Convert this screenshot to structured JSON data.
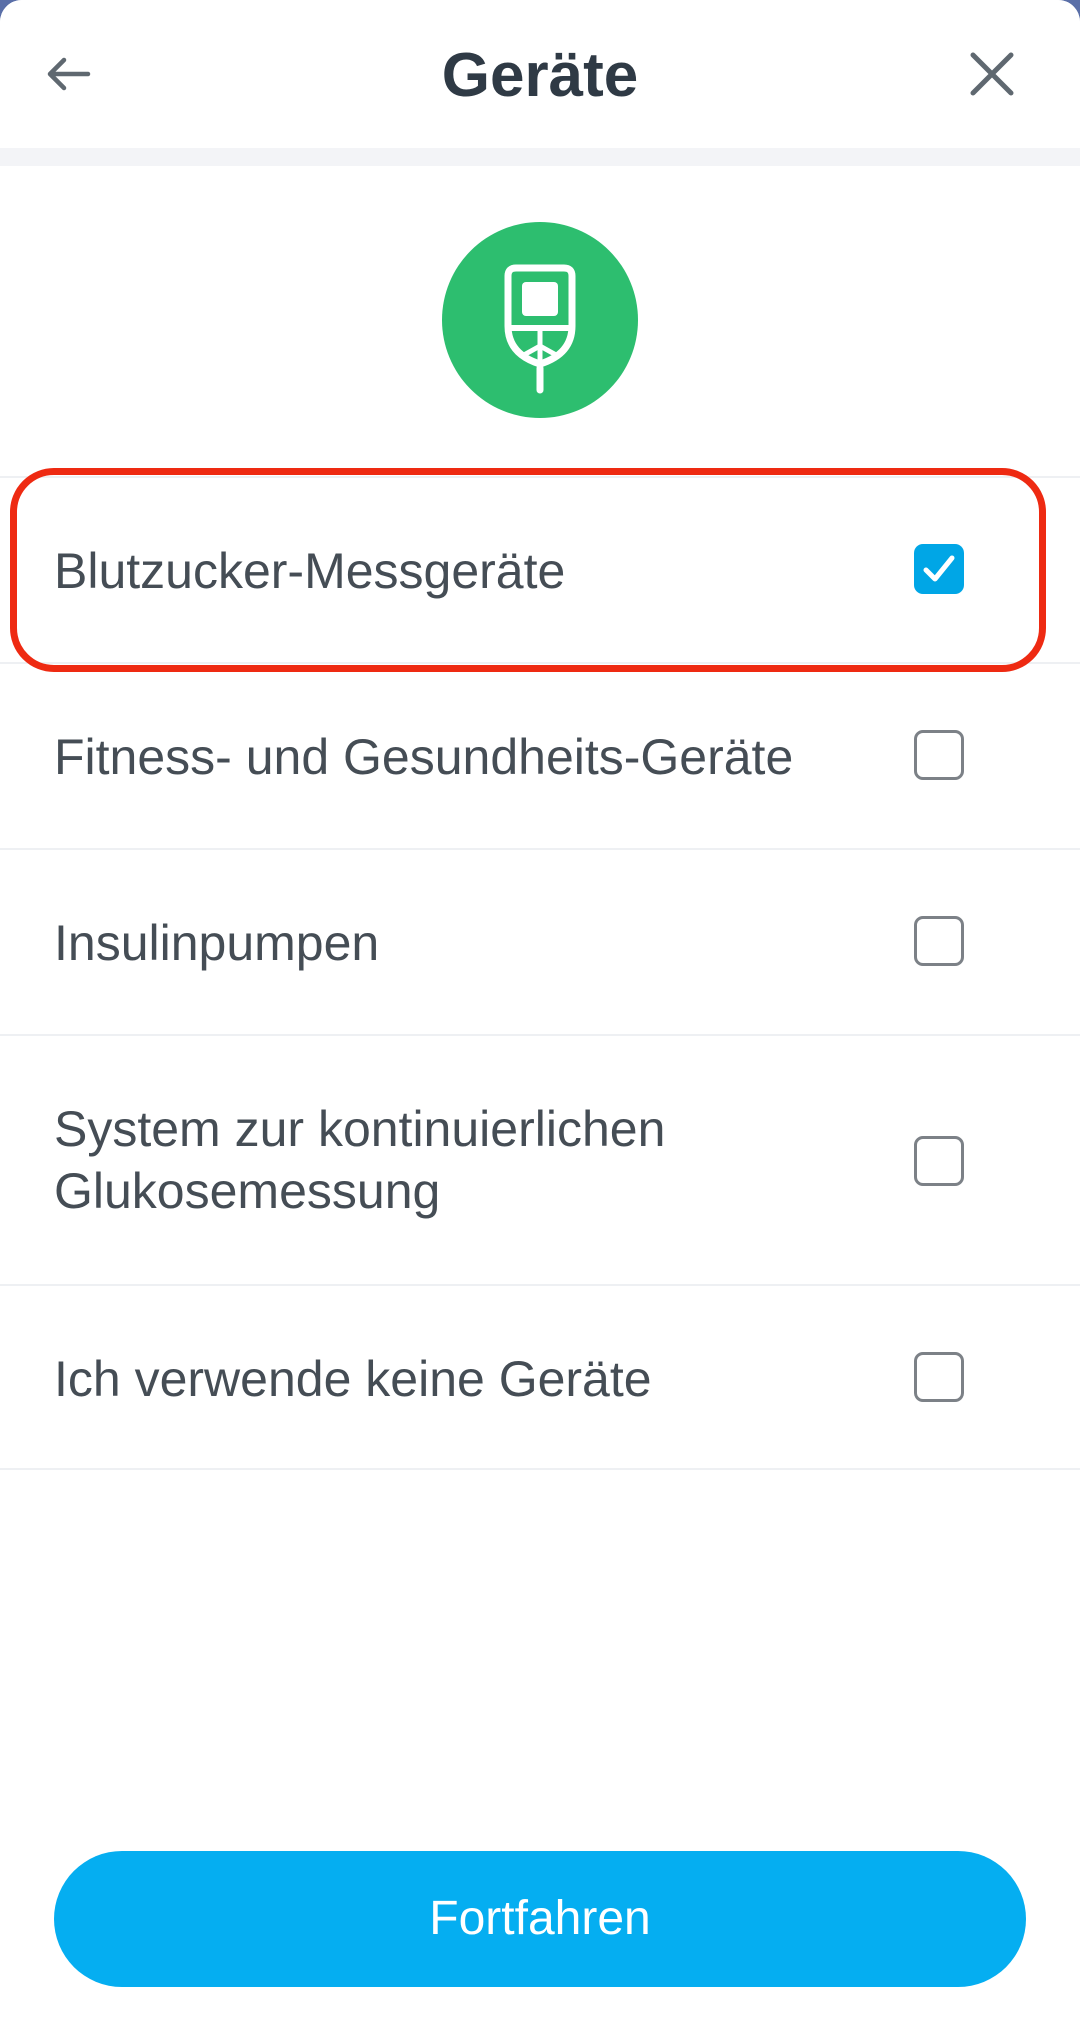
{
  "header": {
    "title": "Geräte",
    "back_icon": "arrow-left-icon",
    "close_icon": "close-icon"
  },
  "hero": {
    "icon": "glucose-meter-icon",
    "icon_bg_color": "#2dbe6f"
  },
  "options": [
    {
      "label": "Blutzucker-Messgeräte",
      "checked": true
    },
    {
      "label": "Fitness- und Gesundheits-Geräte",
      "checked": false
    },
    {
      "label": "Insulinpumpen",
      "checked": false
    },
    {
      "label": "System zur kontinuierlichen Glukosemessung",
      "checked": false
    },
    {
      "label": "Ich verwende keine Geräte",
      "checked": false
    }
  ],
  "highlight": {
    "target": "Blutzucker-Messgeräte",
    "color": "#ee2a12"
  },
  "cta": {
    "label": "Fortfahren",
    "color": "#05aef1"
  },
  "colors": {
    "checkbox_checked": "#00a6e6",
    "text": "#454d55",
    "title": "#2f3a45"
  }
}
